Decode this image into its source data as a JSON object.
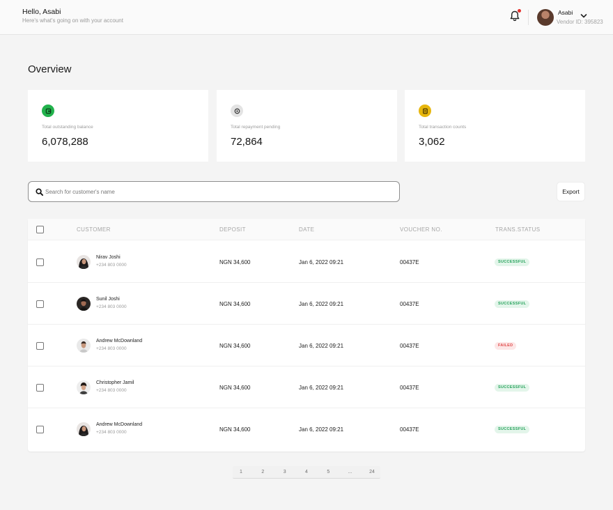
{
  "header": {
    "greeting": "Hello, Asabi",
    "subtitle": "Here's what's going on with your account",
    "user": {
      "name": "Asabi",
      "vendor_id": "Vendor ID: 395823"
    },
    "notification_dot_color": "#e5322e"
  },
  "overview": {
    "title": "Overview",
    "cards": [
      {
        "label": "Total outstanding balance",
        "value": "6,078,288",
        "icon": "wallet-icon",
        "icon_color": "#22b24c"
      },
      {
        "label": "Total repayment pending",
        "value": "72,864",
        "icon": "pending-icon",
        "icon_color": "#e3e3e3"
      },
      {
        "label": "Total transaction counts",
        "value": "3,062",
        "icon": "receipt-icon",
        "icon_color": "#e7b60d"
      }
    ]
  },
  "search": {
    "placeholder": "Search for customer's name"
  },
  "export_label": "Export",
  "table": {
    "columns": [
      "CUSTOMER",
      "DEPOSIT",
      "DATE",
      "VOUCHER NO.",
      "TRANS.STATUS"
    ],
    "rows": [
      {
        "name": "Nirav Joshi",
        "phone": "+234 803 0000",
        "deposit": "NGN 34,600",
        "date": "Jan 6, 2022 09:21",
        "voucher": "00437E",
        "status": "SUCCESSFUL"
      },
      {
        "name": "Sunil Joshi",
        "phone": "+234 803 0000",
        "deposit": "NGN 34,600",
        "date": "Jan 6, 2022 09:21",
        "voucher": "00437E",
        "status": "SUCCESSFUL"
      },
      {
        "name": "Andrew McDownland",
        "phone": "+234 803 0000",
        "deposit": "NGN 34,600",
        "date": "Jan 6, 2022 09:21",
        "voucher": "00437E",
        "status": "FAILED"
      },
      {
        "name": "Christopher Jamil",
        "phone": "+234 803 0000",
        "deposit": "NGN 34,600",
        "date": "Jan 6, 2022 09:21",
        "voucher": "00437E",
        "status": "SUCCESSFUL"
      },
      {
        "name": "Andrew McDownland",
        "phone": "+234 803 0000",
        "deposit": "NGN 34,600",
        "date": "Jan 6, 2022 09:21",
        "voucher": "00437E",
        "status": "SUCCESSFUL"
      }
    ],
    "status_colors": {
      "SUCCESSFUL": "#27a35c",
      "FAILED": "#e04a4a"
    }
  },
  "pagination": [
    "1",
    "2",
    "3",
    "4",
    "5",
    "...",
    "24"
  ]
}
